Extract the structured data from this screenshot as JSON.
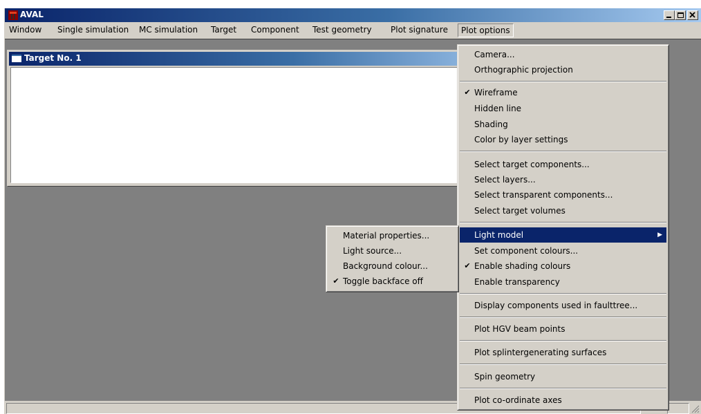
{
  "window": {
    "title": "AVAL",
    "minimize": "_",
    "maximize": "□",
    "close": "×"
  },
  "menubar": {
    "items": [
      "Window",
      "Single simulation",
      "MC simulation",
      "Target",
      "Component",
      "Test geometry",
      "Plot signature",
      "Plot options"
    ]
  },
  "child_window": {
    "title": "Target No. 1"
  },
  "plot_options_menu": {
    "camera": "Camera...",
    "ortho": "Orthographic projection",
    "wireframe": "Wireframe",
    "hidden_line": "Hidden line",
    "shading": "Shading",
    "color_by_layer": "Color by layer settings",
    "select_components": "Select target components...",
    "select_layers": "Select layers...",
    "select_transparent": "Select transparent components...",
    "select_volumes": "Select target volumes",
    "light_model": "Light model",
    "set_colours": "Set component colours...",
    "enable_shading_colours": "Enable shading colours",
    "enable_transparency": "Enable transparency",
    "display_faulttree": "Display components used in faulttree...",
    "plot_hgv": "Plot HGV beam points",
    "plot_splinter": "Plot splintergenerating surfaces",
    "spin": "Spin geometry",
    "plot_axes": "Plot co-ordinate axes",
    "checked": [
      "Wireframe",
      "Enable shading colours"
    ]
  },
  "light_model_submenu": {
    "material": "Material properties...",
    "light_source": "Light source...",
    "background": "Background colour...",
    "toggle_backface": "Toggle backface off",
    "checked": [
      "Toggle backface off"
    ]
  },
  "check_mark": "✔",
  "submenu_arrow": "▶"
}
